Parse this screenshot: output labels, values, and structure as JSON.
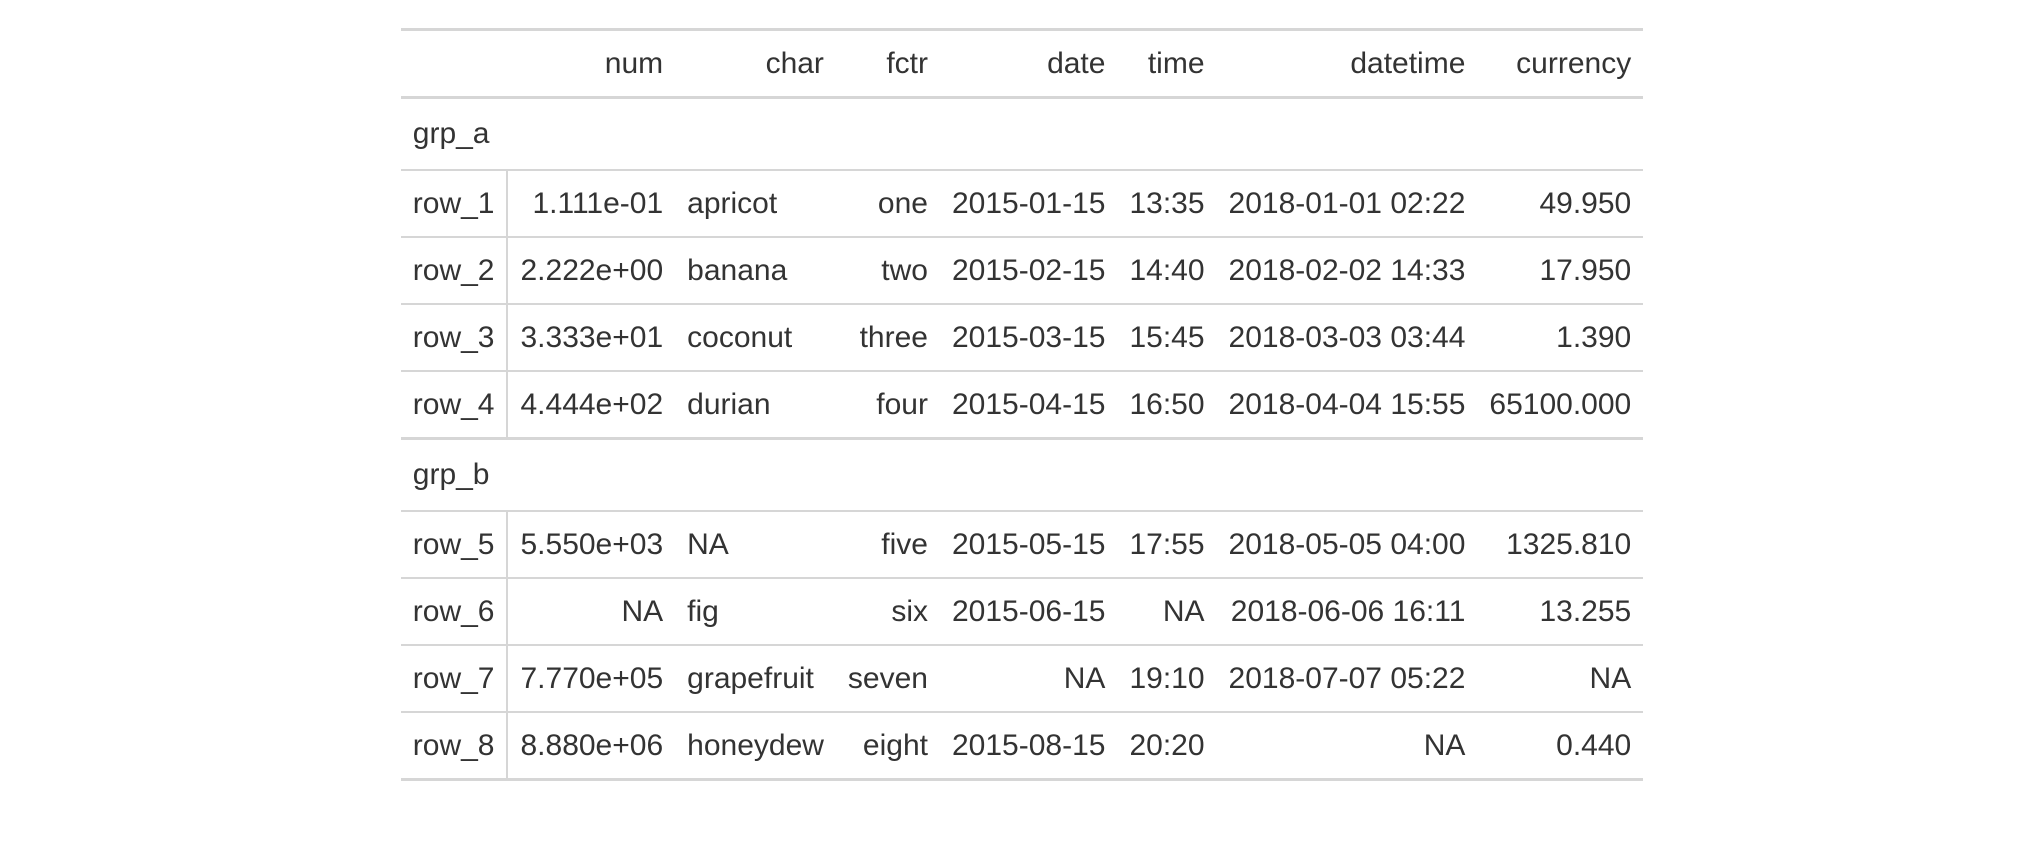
{
  "headers": {
    "stub": "",
    "num": "num",
    "char": "char",
    "fctr": "fctr",
    "date": "date",
    "time": "time",
    "datetime": "datetime",
    "currency": "currency"
  },
  "groups": [
    {
      "label": "grp_a",
      "rows": [
        {
          "stub": "row_1",
          "num": "1.111e-01",
          "char": "apricot",
          "fctr": "one",
          "date": "2015-01-15",
          "time": "13:35",
          "datetime": "2018-01-01 02:22",
          "currency": "49.950"
        },
        {
          "stub": "row_2",
          "num": "2.222e+00",
          "char": "banana",
          "fctr": "two",
          "date": "2015-02-15",
          "time": "14:40",
          "datetime": "2018-02-02 14:33",
          "currency": "17.950"
        },
        {
          "stub": "row_3",
          "num": "3.333e+01",
          "char": "coconut",
          "fctr": "three",
          "date": "2015-03-15",
          "time": "15:45",
          "datetime": "2018-03-03 03:44",
          "currency": "1.390"
        },
        {
          "stub": "row_4",
          "num": "4.444e+02",
          "char": "durian",
          "fctr": "four",
          "date": "2015-04-15",
          "time": "16:50",
          "datetime": "2018-04-04 15:55",
          "currency": "65100.000"
        }
      ]
    },
    {
      "label": "grp_b",
      "rows": [
        {
          "stub": "row_5",
          "num": "5.550e+03",
          "char": "NA",
          "fctr": "five",
          "date": "2015-05-15",
          "time": "17:55",
          "datetime": "2018-05-05 04:00",
          "currency": "1325.810"
        },
        {
          "stub": "row_6",
          "num": "NA",
          "char": "fig",
          "fctr": "six",
          "date": "2015-06-15",
          "time": "NA",
          "datetime": "2018-06-06 16:11",
          "currency": "13.255"
        },
        {
          "stub": "row_7",
          "num": "7.770e+05",
          "char": "grapefruit",
          "fctr": "seven",
          "date": "NA",
          "time": "19:10",
          "datetime": "2018-07-07 05:22",
          "currency": "NA"
        },
        {
          "stub": "row_8",
          "num": "8.880e+06",
          "char": "honeydew",
          "fctr": "eight",
          "date": "2015-08-15",
          "time": "20:20",
          "datetime": "NA",
          "currency": "0.440"
        }
      ]
    }
  ]
}
